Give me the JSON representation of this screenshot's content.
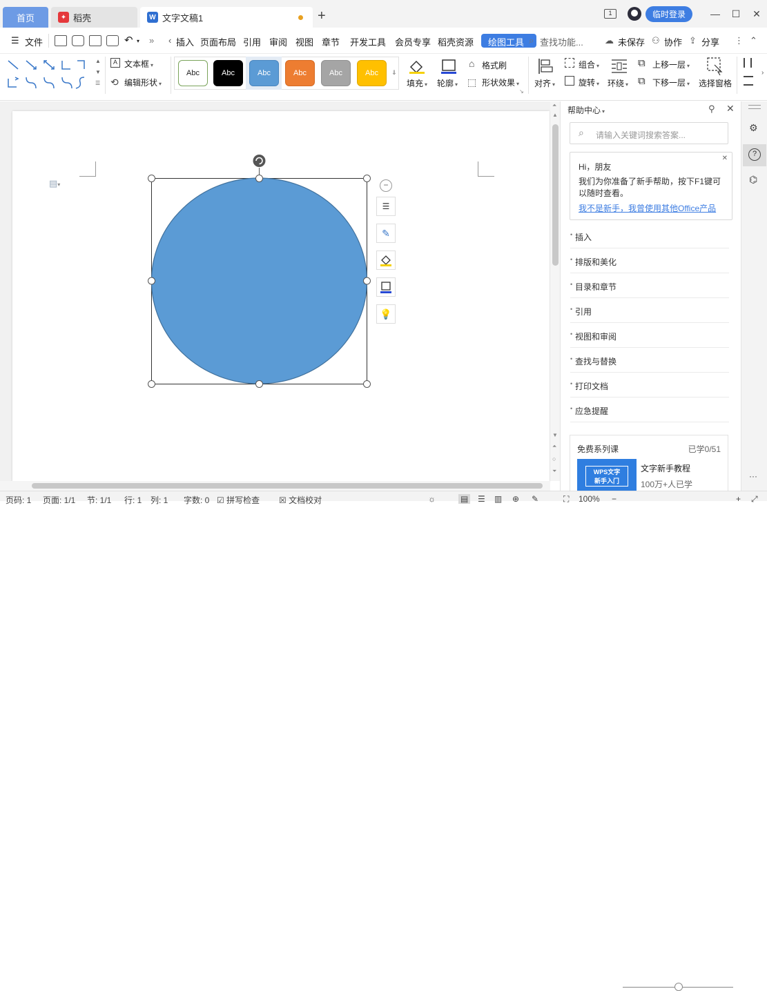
{
  "titlebar": {
    "tabs": [
      {
        "label": "首页"
      },
      {
        "label": "稻壳"
      },
      {
        "label": "文字文稿1"
      }
    ],
    "login_label": "临时登录",
    "window_controls": [
      "minimize-icon",
      "restore-icon",
      "close-icon"
    ]
  },
  "menubar": {
    "file_label": "文件",
    "items": [
      "插入",
      "页面布局",
      "引用",
      "审阅",
      "视图",
      "章节",
      "开发工具",
      "会员专享",
      "稻壳资源"
    ],
    "active_tab": "绘图工具",
    "search_placeholder": "查找功能...",
    "unsaved_label": "未保存",
    "collab_label": "协作",
    "share_label": "分享"
  },
  "ribbon": {
    "textbox_label": "文本框",
    "edit_shape_label": "编辑形状",
    "style_presets": [
      {
        "text": "Abc",
        "bg": "#ffffff",
        "fg": "#222222",
        "border": "#7aa35a"
      },
      {
        "text": "Abc",
        "bg": "#000000",
        "fg": "#ffffff",
        "border": "#000000"
      },
      {
        "text": "Abc",
        "bg": "#5b9bd5",
        "fg": "#ffffff",
        "border": "#4a86bf"
      },
      {
        "text": "Abc",
        "bg": "#ed7d31",
        "fg": "#ffffff",
        "border": "#d56a22"
      },
      {
        "text": "Abc",
        "bg": "#a5a5a5",
        "fg": "#ffffff",
        "border": "#909090"
      },
      {
        "text": "Abc",
        "bg": "#ffc000",
        "fg": "#ffffff",
        "border": "#e0a800"
      }
    ],
    "fill_label": "填充",
    "outline_label": "轮廓",
    "format_painter_label": "格式刷",
    "shape_effects_label": "形状效果",
    "align_label": "对齐",
    "group_label": "组合",
    "rotate_label": "旋转",
    "wrap_label": "环绕",
    "bring_forward_label": "上移一层",
    "send_backward_label": "下移一层",
    "selection_pane_label": "选择窗格"
  },
  "document": {
    "shape_fill": "#5b9bd5",
    "shape_stroke": "#41719c"
  },
  "help": {
    "title": "帮助中心",
    "search_placeholder": "请输入关键词搜索答案...",
    "greeting": "Hi，朋友",
    "welcome_text": "我们为你准备了新手帮助，按下F1键可以随时查看。",
    "welcome_link": "我不是新手，我曾使用其他Office产品",
    "items": [
      "插入",
      "排版和美化",
      "目录和章节",
      "引用",
      "视图和审阅",
      "查找与替换",
      "打印文档",
      "应急提醒"
    ],
    "course_title": "免费系列课",
    "course_progress": "已学0/51",
    "course_name": "文字新手教程",
    "course_learners": "100万+人已学",
    "course_thumb_line1": "WPS文字",
    "course_thumb_line2": "新手入门"
  },
  "statusbar": {
    "page_num": "页码: 1",
    "pages": "页面: 1/1",
    "section": "节: 1/1",
    "row": "行: 1",
    "col": "列: 1",
    "words": "字数: 0",
    "spell_check": "拼写检查",
    "doc_check": "文档校对",
    "zoom": "100%"
  }
}
